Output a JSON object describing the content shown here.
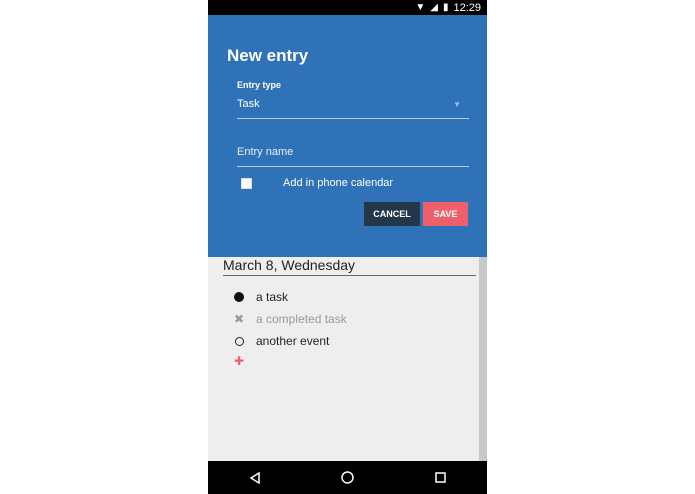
{
  "status_bar": {
    "time": "12:29"
  },
  "dialog": {
    "title": "New entry",
    "entry_type_label": "Entry type",
    "entry_type_value": "Task",
    "entry_name_placeholder": "Entry name",
    "calendar_checkbox_label": "Add in phone calendar",
    "cancel_label": "CANCEL",
    "save_label": "SAVE"
  },
  "list": {
    "date_header": "March 8, Wednesday",
    "items": [
      {
        "label": "a task",
        "state": "task"
      },
      {
        "label": "a completed task",
        "state": "completed"
      },
      {
        "label": "another event",
        "state": "event"
      }
    ]
  },
  "colors": {
    "dialog_bg": "#2f72b8",
    "save_button": "#f0606a",
    "cancel_button": "#23374a"
  },
  "icons": {
    "task": "filled-circle-icon",
    "completed": "x-icon",
    "event": "hollow-circle-icon",
    "add": "plus-icon"
  }
}
